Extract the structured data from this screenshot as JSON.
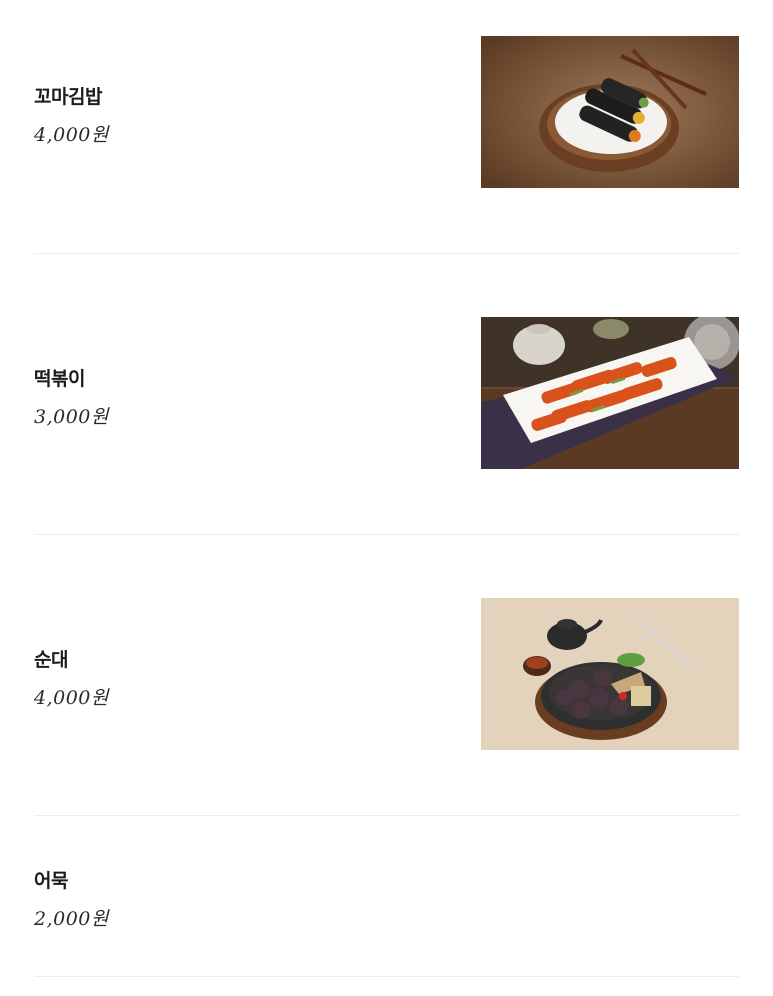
{
  "menu": {
    "items": [
      {
        "name": "꼬마김밥",
        "price": "4,000원",
        "photo_icon": "mini-kimbap-photo"
      },
      {
        "name": "떡볶이",
        "price": "3,000원",
        "photo_icon": "tteokbokki-photo"
      },
      {
        "name": "순대",
        "price": "4,000원",
        "photo_icon": "sundae-photo"
      },
      {
        "name": "어묵",
        "price": "2,000원"
      }
    ]
  },
  "colors": {
    "divider": "#ececec",
    "text": "#1c1c1c",
    "background": "#ffffff"
  }
}
